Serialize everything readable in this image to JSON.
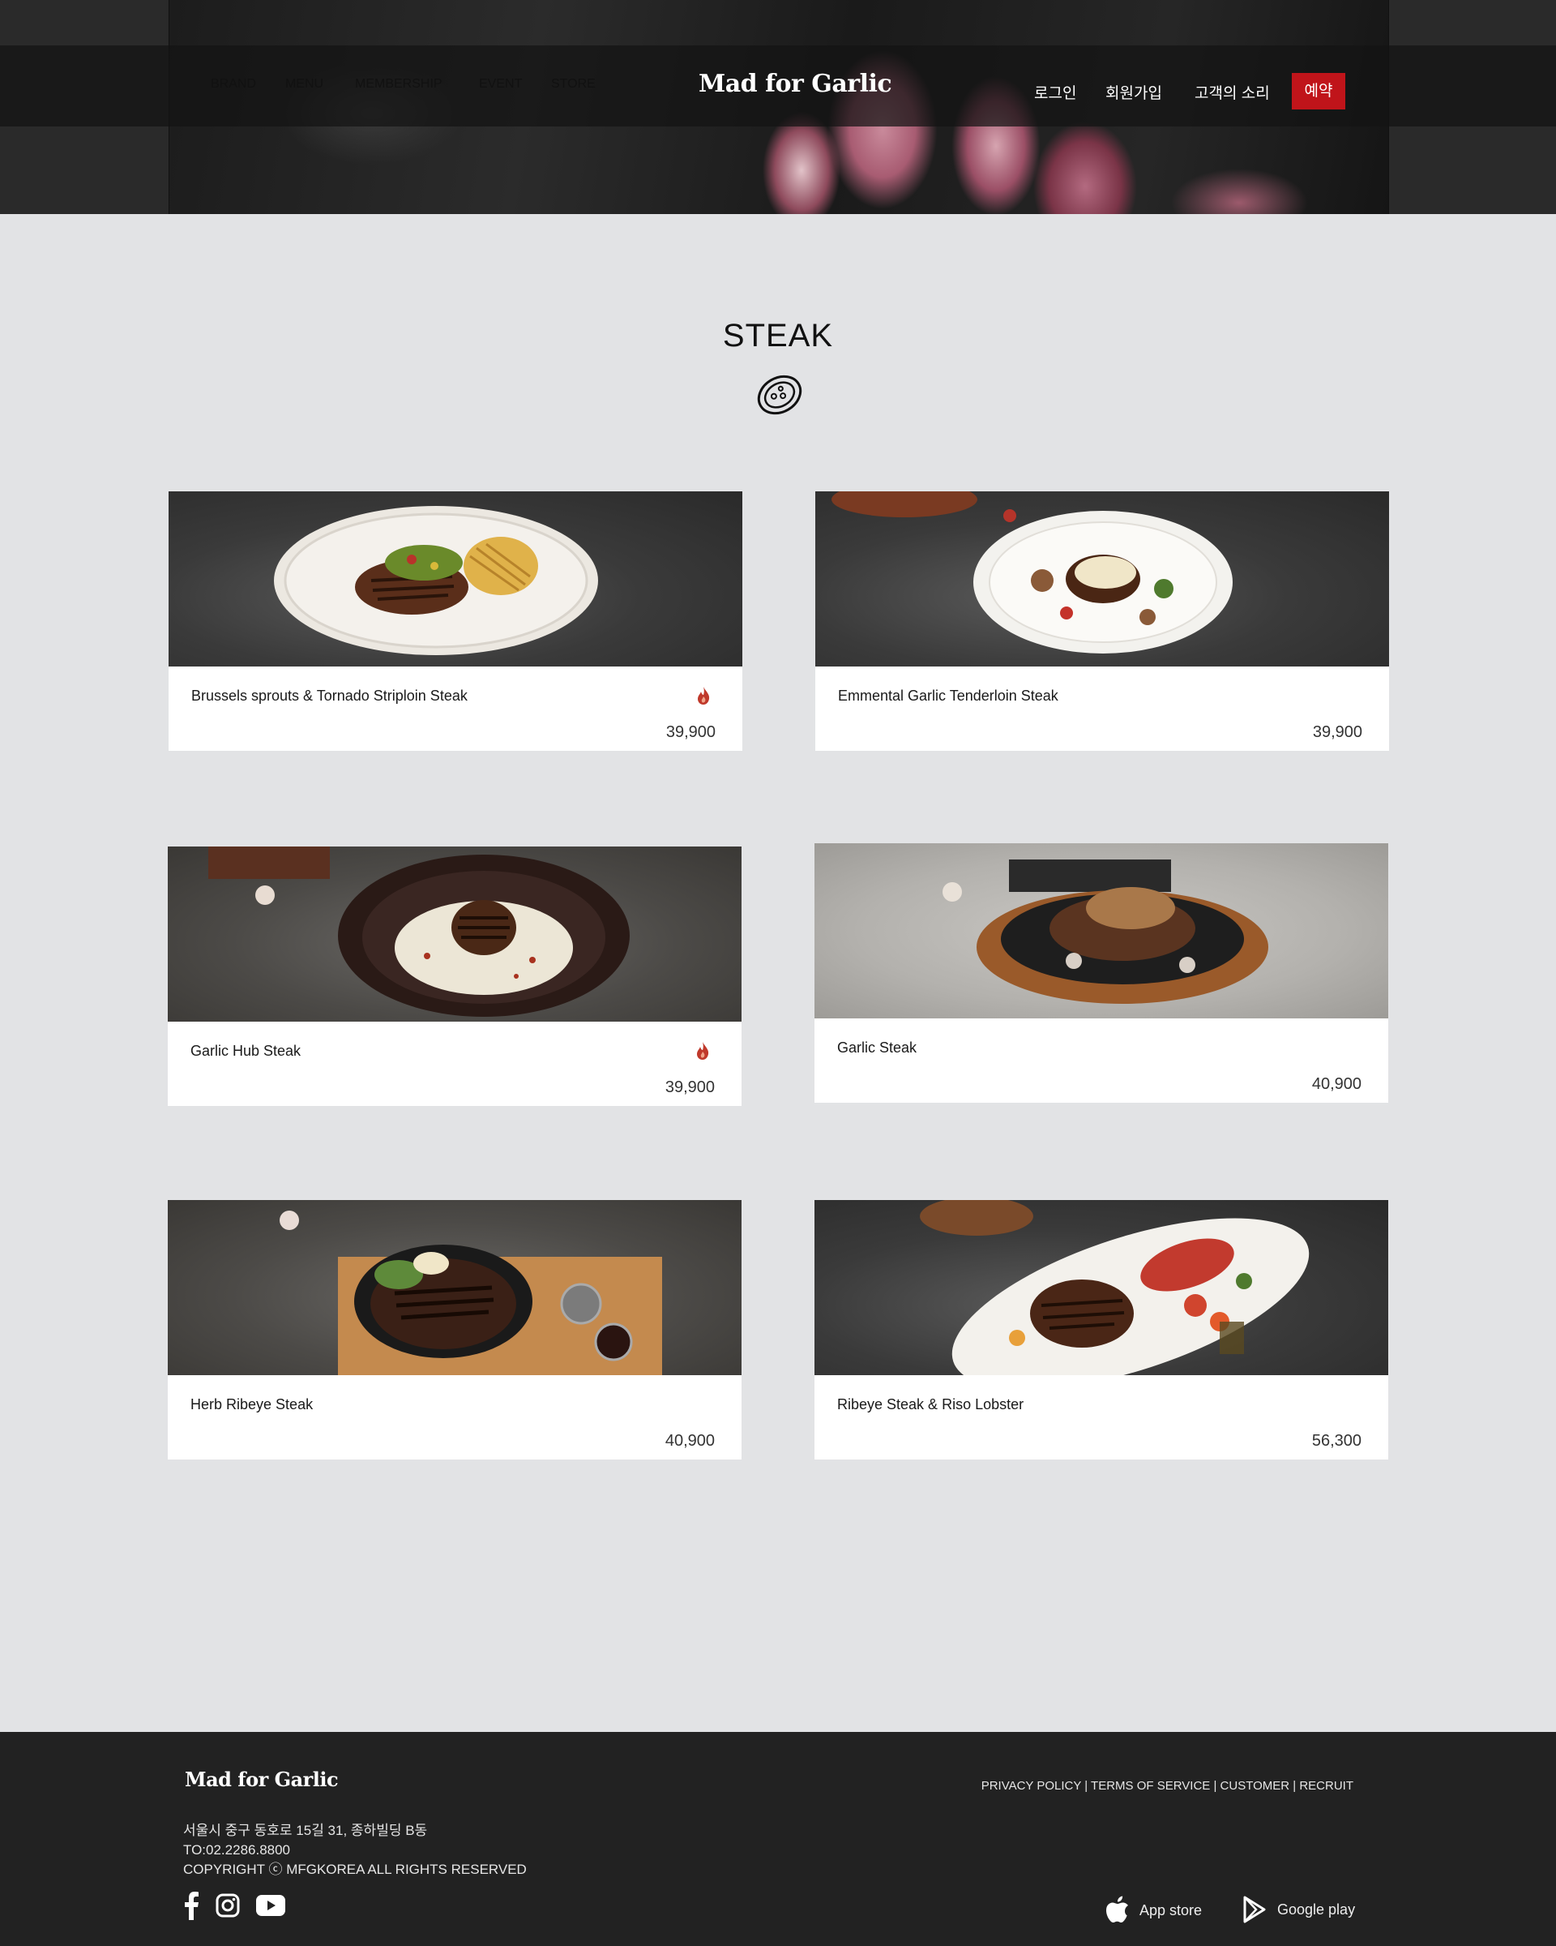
{
  "header": {
    "nav": [
      "BRAND",
      "MENU",
      "MEMBERSHIP",
      "EVENT",
      "STORE"
    ],
    "logo": "Mad for Garlic",
    "login": "로그인",
    "signup": "회원가입",
    "voc": "고객의 소리",
    "reserve": "예약"
  },
  "section": {
    "title": "STEAK",
    "icon": "steak-plate-icon"
  },
  "items": [
    {
      "name": "Brussels sprouts & Tornado Striploin Steak",
      "price": "39,900",
      "spicy": true
    },
    {
      "name": "Emmental Garlic Tenderloin Steak",
      "price": "39,900",
      "spicy": false
    },
    {
      "name": "Garlic Hub Steak",
      "price": "39,900",
      "spicy": true
    },
    {
      "name": "Garlic Steak",
      "price": "40,900",
      "spicy": false
    },
    {
      "name": "Herb Ribeye Steak",
      "price": "40,900",
      "spicy": false
    },
    {
      "name": "Ribeye Steak & Riso Lobster",
      "price": "56,300",
      "spicy": false
    }
  ],
  "footer": {
    "logo": "Mad for Garlic",
    "address": "서울시 중구 동호로 15길 31, 종하빌딩 B동",
    "tel": "TO:02.2286.8800",
    "copyright": "COPYRIGHT ⓒ MFGKOREA ALL RIGHTS RESERVED",
    "links": [
      "PRIVACY POLICY",
      "TERMS OF SERVICE",
      "CUSTOMER",
      "RECRUIT"
    ],
    "app_store": "App store",
    "google_play": "Google play",
    "social_icons": [
      "facebook-icon",
      "instagram-icon",
      "youtube-icon"
    ]
  },
  "colors": {
    "accent": "#c0141a",
    "page_bg": "#e2e3e5",
    "footer_bg": "#222222"
  }
}
